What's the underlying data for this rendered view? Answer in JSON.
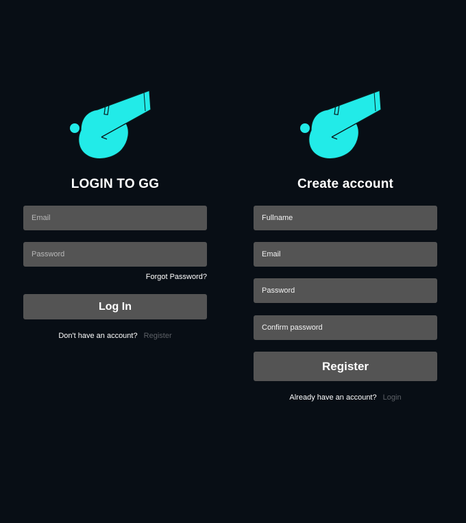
{
  "colors": {
    "background": "#080e15",
    "field": "#545454",
    "accent": "#22ebe8",
    "muted_link": "#5d6167"
  },
  "icons": {
    "logo": "whistle-logo-icon"
  },
  "login": {
    "title": "LOGIN TO GG",
    "email_placeholder": "Email",
    "password_placeholder": "Password",
    "forgot_password": "Forgot Password?",
    "submit_label": "Log In",
    "prompt_text": "Don't have an account?",
    "prompt_link": "Register"
  },
  "register": {
    "title": "Create account",
    "fullname_placeholder": "Fullname",
    "email_placeholder": "Email",
    "password_placeholder": "Password",
    "confirm_placeholder": "Confirm password",
    "submit_label": "Register",
    "prompt_text": "Already have an account?",
    "prompt_link": "Login"
  }
}
